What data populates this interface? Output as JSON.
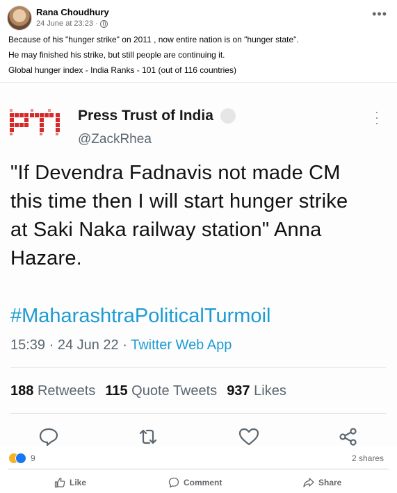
{
  "post": {
    "author": "Rana Choudhury",
    "timestamp": "24 June at 23:23 ·",
    "caption": [
      "Because of his \"hunger strike\" on 2011 , now entire nation is on \"hunger state\".",
      "He may finished his strike, but still people are continuing it.",
      "Global hunger index - India Ranks - 101 (out of 116 countries)"
    ]
  },
  "tweet": {
    "logo_text": "PTI",
    "source_name": "Press Trust of India",
    "handle": "@ZackRhea",
    "text_lines": [
      "\"If Devendra Fadnavis not made CM",
      "this time then I will start hunger strike",
      "at Saki Naka railway station\" Anna",
      "Hazare."
    ],
    "hashtag": "#MaharashtraPoliticalTurmoil",
    "time": "15:39 · 24 Jun 22 · ",
    "app": "Twitter Web App",
    "stats": {
      "retweets_count": "188",
      "retweets_label": "Retweets",
      "quotes_count": "115",
      "quotes_label": "Quote Tweets",
      "likes_count": "937",
      "likes_label": "Likes"
    }
  },
  "footer": {
    "reaction_count": "9",
    "shares": "2 shares",
    "like_label": "Like",
    "comment_label": "Comment",
    "share_label": "Share"
  },
  "colors": {
    "twitter_blue": "#1d9bd1",
    "pti_red": "#d42a2a",
    "fb_gray": "#65676b"
  }
}
